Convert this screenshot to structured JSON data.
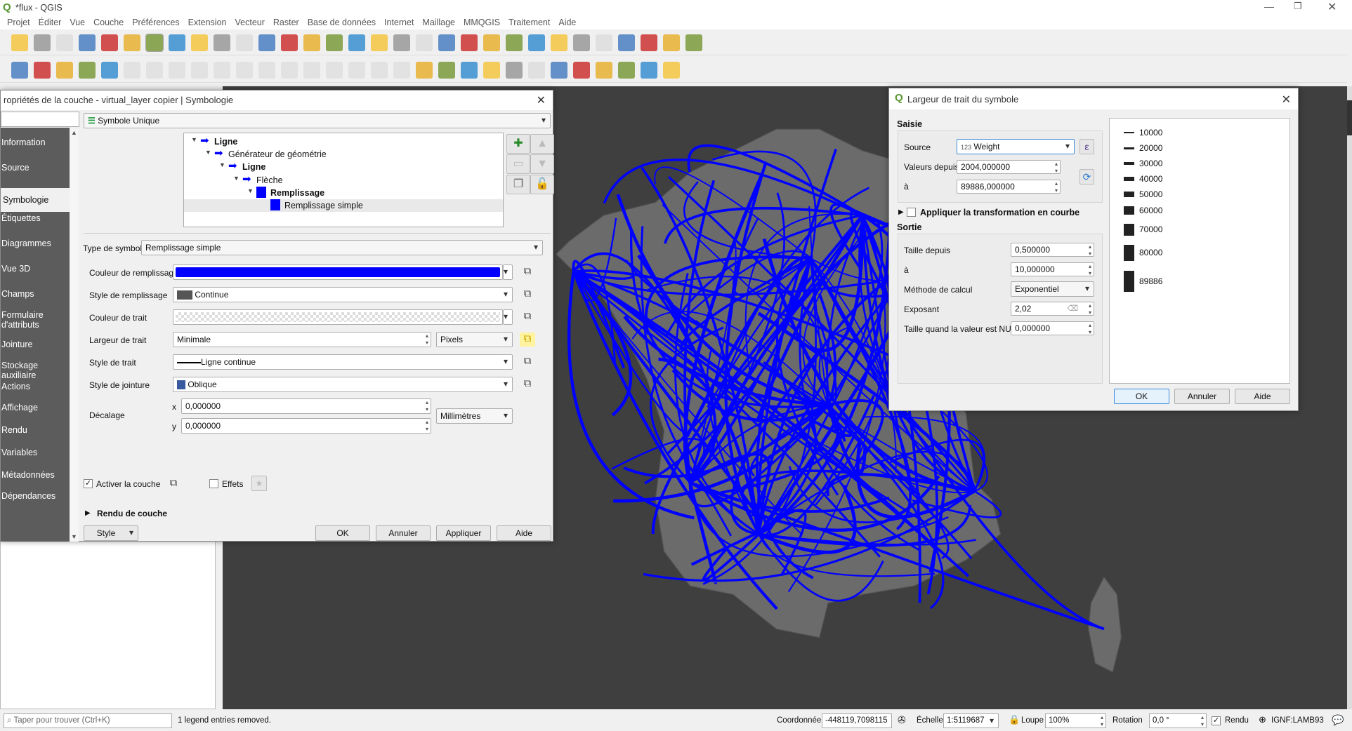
{
  "app": {
    "title": "*flux - QGIS",
    "accent": "#0000ff"
  },
  "menu": [
    "Projet",
    "Éditer",
    "Vue",
    "Couche",
    "Préférences",
    "Extension",
    "Vecteur",
    "Raster",
    "Base de données",
    "Internet",
    "Maillage",
    "MMQGIS",
    "Traitement",
    "Aide"
  ],
  "toolbar1": [
    "new-project",
    "open-project",
    "save-project",
    "new-print-layout",
    "layout-manager",
    "style-manager",
    "pan",
    "pan-to-selection",
    "zoom-in",
    "zoom-out",
    "zoom-full",
    "zoom-to-selection",
    "zoom-to-layer",
    "zoom-native",
    "zoom-last",
    "zoom-next",
    "new-bookmark",
    "show-bookmarks",
    "spatial-bookmarks",
    "refresh",
    "identify",
    "run-action",
    "select-features",
    "attribute-table",
    "deselect",
    "open-field-calculator",
    "statistics",
    "sum",
    "measure",
    "map-tips",
    "text-annotation"
  ],
  "toolbar2": [
    "data-source-manager",
    "new-geopackage",
    "new-shapefile",
    "new-spatialite",
    "new-virtual-layer",
    "digitize",
    "current-edits",
    "toggle-editing",
    "save-edits",
    "add-feature",
    "vertex-tool",
    "modify-attributes",
    "delete",
    "cut",
    "copy",
    "paste",
    "undo",
    "redo",
    "label-tool",
    "diagram",
    "pin-labels",
    "highlight-labels",
    "rotate-label",
    "change-label",
    "move-label",
    "show-hide-labels",
    "osm-plugin",
    "python-console",
    "globe",
    "help"
  ],
  "layer_dialog": {
    "title": "ropriétés de la couche - virtual_layer copier | Symbologie",
    "nav": [
      {
        "label": "Information"
      },
      {
        "label": "Source"
      },
      {
        "label": "Symbologie",
        "selected": true
      },
      {
        "label": "Étiquettes"
      },
      {
        "label": "Diagrammes"
      },
      {
        "label": "Vue 3D"
      },
      {
        "label": "Champs"
      },
      {
        "label": "Formulaire d'attributs"
      },
      {
        "label": "Jointure"
      },
      {
        "label": "Stockage auxiliaire"
      },
      {
        "label": "Actions"
      },
      {
        "label": "Affichage"
      },
      {
        "label": "Rendu"
      },
      {
        "label": "Variables"
      },
      {
        "label": "Métadonnées"
      },
      {
        "label": "Dépendances"
      }
    ],
    "renderer": "Symbole Unique",
    "tree": [
      {
        "label": "Ligne",
        "bold": true,
        "level": 0,
        "icon": "arrow"
      },
      {
        "label": "Générateur de géométrie",
        "level": 1,
        "icon": "arrow"
      },
      {
        "label": "Ligne",
        "bold": true,
        "level": 2,
        "icon": "arrow"
      },
      {
        "label": "Flèche",
        "level": 3,
        "icon": "arrow"
      },
      {
        "label": "Remplissage",
        "bold": true,
        "level": 4,
        "icon": "fill"
      },
      {
        "label": "Remplissage simple",
        "level": 5,
        "icon": "fill",
        "selected": true
      }
    ],
    "symbol_type_label": "Type de symbole",
    "symbol_type": "Remplissage simple",
    "fill_color_label": "Couleur de remplissage",
    "fill_color": "#0000ff",
    "fill_style_label": "Style de remplissage",
    "fill_style": "Continue",
    "stroke_color_label": "Couleur de trait",
    "stroke_width_label": "Largeur de trait",
    "stroke_width": "Minimale",
    "stroke_unit": "Pixels",
    "stroke_style_label": "Style de trait",
    "stroke_style": "Ligne continue",
    "join_style_label": "Style de jointure",
    "join_style": "Oblique",
    "offset_label": "Décalage",
    "offset_x_label": "x",
    "offset_x": "0,000000",
    "offset_y_label": "y",
    "offset_y": "0,000000",
    "offset_unit": "Millimètres",
    "enable_layer": "Activer la couche",
    "effects": "Effets",
    "layer_rendering": "Rendu de couche",
    "style_btn": "Style",
    "ok": "OK",
    "cancel": "Annuler",
    "apply": "Appliquer",
    "help": "Aide"
  },
  "width_dialog": {
    "title": "Largeur de trait du symbole",
    "input_header": "Saisie",
    "source_label": "Source",
    "source_prefix": "123",
    "source": "Weight",
    "values_from_label": "Valeurs depuis",
    "values_from": "2004,000000",
    "values_to_label": "à",
    "values_to": "89886,000000",
    "curve": "Appliquer la transformation en courbe",
    "output_header": "Sortie",
    "size_from_label": "Taille depuis",
    "size_from": "0,500000",
    "size_to_label": "à",
    "size_to": "10,000000",
    "method_label": "Méthode de calcul",
    "method": "Exponentiel",
    "exponent_label": "Exposant",
    "exponent": "2,02",
    "null_label": "Taille quand la valeur est NULL",
    "null_size": "0,000000",
    "legend": [
      "10000",
      "20000",
      "30000",
      "40000",
      "50000",
      "60000",
      "70000",
      "80000",
      "89886"
    ],
    "ok": "OK",
    "cancel": "Annuler",
    "help": "Aide"
  },
  "status": {
    "search_placeholder": "Taper pour trouver (Ctrl+K)",
    "message": "1 legend entries removed.",
    "coord_label": "Coordonnée",
    "coord": "-448119,7098115",
    "scale_label": "Échelle",
    "scale": "1:5119687",
    "magnifier_label": "Loupe",
    "magnifier": "100%",
    "rotation_label": "Rotation",
    "rotation": "0,0 °",
    "render_label": "Rendu",
    "crs": "IGNF:LAMB93"
  }
}
